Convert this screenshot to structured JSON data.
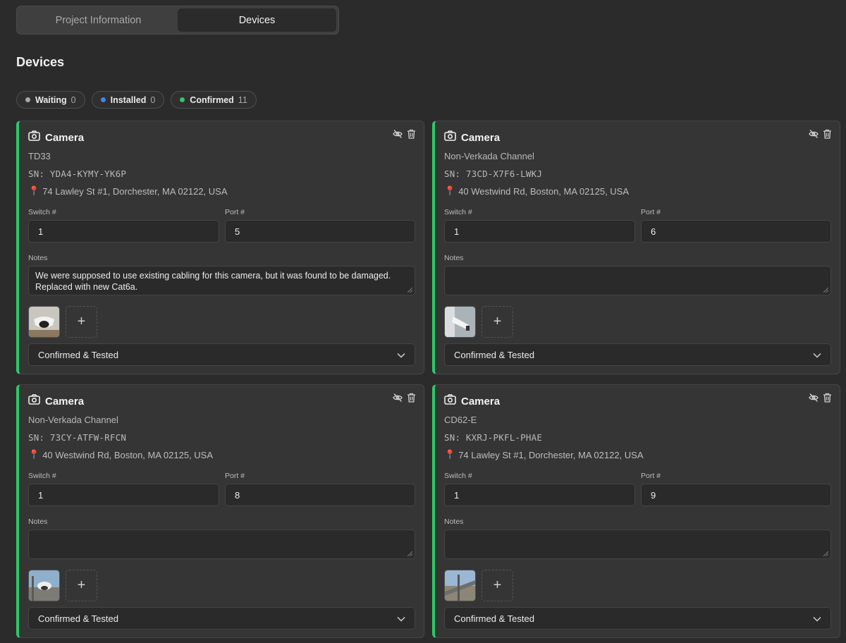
{
  "tabs": [
    {
      "label": "Project Information",
      "active": false
    },
    {
      "label": "Devices",
      "active": true
    }
  ],
  "section_title": "Devices",
  "status_counts": [
    {
      "label": "Waiting",
      "count": "0",
      "color": "#a9a9a9"
    },
    {
      "label": "Installed",
      "count": "0",
      "color": "#3f83f8"
    },
    {
      "label": "Confirmed",
      "count": "11",
      "color": "#31c469"
    }
  ],
  "field_labels": {
    "switch": "Switch #",
    "port": "Port #",
    "notes": "Notes"
  },
  "accent_color": "#2fc766",
  "devices": [
    {
      "type": "Camera",
      "name": "TD33",
      "sn": "SN: YDA4-KYMY-YK6P",
      "address": "74 Lawley St #1, Dorchester, MA 02122, USA",
      "switch": "1",
      "port": "5",
      "notes": "We were supposed to use existing cabling for this camera, but it was found to be damaged. Replaced with new Cat6a.",
      "status": "Confirmed & Tested"
    },
    {
      "type": "Camera",
      "name": "Non-Verkada Channel",
      "sn": "SN: 73CD-X7F6-LWKJ",
      "address": "40 Westwind Rd, Boston, MA 02125, USA",
      "switch": "1",
      "port": "6",
      "notes": "",
      "status": "Confirmed & Tested"
    },
    {
      "type": "Camera",
      "name": "Non-Verkada Channel",
      "sn": "SN: 73CY-ATFW-RFCN",
      "address": "40 Westwind Rd, Boston, MA 02125, USA",
      "switch": "1",
      "port": "8",
      "notes": "",
      "status": "Confirmed & Tested"
    },
    {
      "type": "Camera",
      "name": "CD62-E",
      "sn": "SN: KXRJ-PKFL-PHAE",
      "address": "74 Lawley St #1, Dorchester, MA 02122, USA",
      "switch": "1",
      "port": "9",
      "notes": "",
      "status": "Confirmed & Tested"
    }
  ]
}
